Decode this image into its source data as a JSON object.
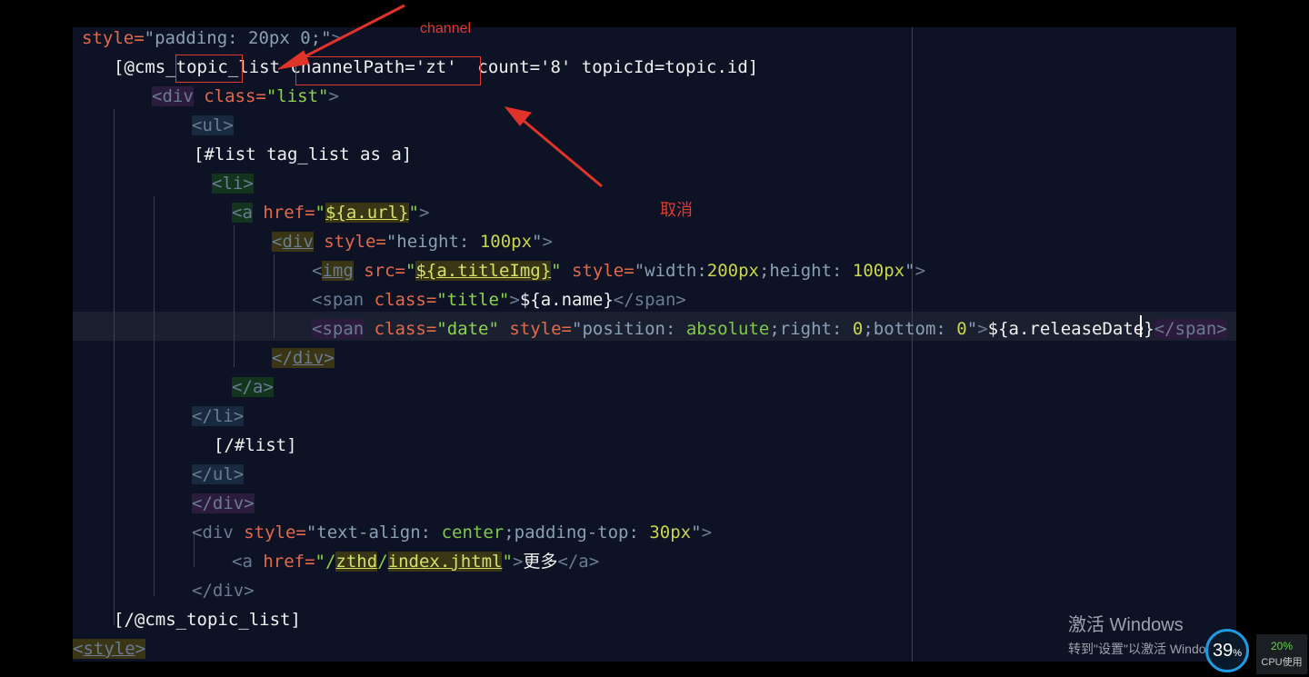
{
  "code_lines": [
    [
      {
        "t": "style=",
        "c": "tk-attr"
      },
      {
        "t": "\"padding: 20px 0;\"",
        "c": "tk-val"
      },
      {
        "t": ">",
        "c": "tk-tag"
      }
    ],
    [
      {
        "t": "[@cms_",
        "c": "tk-txt"
      },
      {
        "t": "topic_",
        "c": "tk-txt"
      },
      {
        "t": "list ",
        "c": "tk-txt"
      },
      {
        "t": "channelPath='zt'",
        "c": "tk-txt"
      },
      {
        "t": "  count='8' topicId=topic.id]",
        "c": "tk-txt"
      }
    ],
    [
      {
        "t": "<div",
        "c": "tk-tag hl-p"
      },
      {
        "t": " class=",
        "c": "tk-attr"
      },
      {
        "t": "\"list\"",
        "c": "tk-str"
      },
      {
        "t": ">",
        "c": "tk-tag"
      }
    ],
    [
      {
        "t": "<ul>",
        "c": "tk-tag hl-b"
      }
    ],
    [
      {
        "t": "[#list tag_list as a]",
        "c": "tk-txt"
      }
    ],
    [
      {
        "t": "<li>",
        "c": "tk-tag hl-g"
      }
    ],
    [
      {
        "t": "<a",
        "c": "tk-tag hl-g"
      },
      {
        "t": " href=",
        "c": "tk-attr"
      },
      {
        "t": "\"",
        "c": "tk-str"
      },
      {
        "t": "${a.url}",
        "c": "tk-interp hl-y"
      },
      {
        "t": "\"",
        "c": "tk-str"
      },
      {
        "t": ">",
        "c": "tk-tag"
      }
    ],
    [
      {
        "t": "<",
        "c": "tk-tag hl-y"
      },
      {
        "t": "div",
        "c": "tk-tag hl-y ul"
      },
      {
        "t": " style=",
        "c": "tk-attr"
      },
      {
        "t": "\"height: ",
        "c": "tk-val"
      },
      {
        "t": "100px",
        "c": "tk-num"
      },
      {
        "t": "\"",
        "c": "tk-val"
      },
      {
        "t": ">",
        "c": "tk-tag"
      }
    ],
    [
      {
        "t": "<",
        "c": "tk-tag"
      },
      {
        "t": "img",
        "c": "tk-tag hl-y ul"
      },
      {
        "t": " src=",
        "c": "tk-attr"
      },
      {
        "t": "\"",
        "c": "tk-str"
      },
      {
        "t": "${a.titleImg}",
        "c": "tk-interp hl-y"
      },
      {
        "t": "\"",
        "c": "tk-str"
      },
      {
        "t": " style=",
        "c": "tk-attr"
      },
      {
        "t": "\"width:",
        "c": "tk-val"
      },
      {
        "t": "200px",
        "c": "tk-num"
      },
      {
        "t": ";height: ",
        "c": "tk-val"
      },
      {
        "t": "100px",
        "c": "tk-num"
      },
      {
        "t": "\"",
        "c": "tk-val"
      },
      {
        "t": ">",
        "c": "tk-tag"
      }
    ],
    [
      {
        "t": "<span",
        "c": "tk-tag"
      },
      {
        "t": " class=",
        "c": "tk-attr"
      },
      {
        "t": "\"title\"",
        "c": "tk-str"
      },
      {
        "t": ">",
        "c": "tk-tag"
      },
      {
        "t": "${a.name}",
        "c": "tk-txt"
      },
      {
        "t": "</span>",
        "c": "tk-tag"
      }
    ],
    [
      {
        "t": "<span",
        "c": "tk-tag hl-p"
      },
      {
        "t": " class=",
        "c": "tk-attr"
      },
      {
        "t": "\"date\"",
        "c": "tk-str"
      },
      {
        "t": " style=",
        "c": "tk-attr"
      },
      {
        "t": "\"position: ",
        "c": "tk-val"
      },
      {
        "t": "absolute",
        "c": "tk-kw"
      },
      {
        "t": ";right: ",
        "c": "tk-val"
      },
      {
        "t": "0",
        "c": "tk-num"
      },
      {
        "t": ";bottom: ",
        "c": "tk-val"
      },
      {
        "t": "0",
        "c": "tk-num"
      },
      {
        "t": "\"",
        "c": "tk-val"
      },
      {
        "t": ">",
        "c": "tk-tag"
      },
      {
        "t": "${a.releaseDate}",
        "c": "tk-txt"
      },
      {
        "t": "</span>",
        "c": "tk-tag hl-p"
      }
    ],
    [
      {
        "t": "</",
        "c": "tk-tag hl-y"
      },
      {
        "t": "div",
        "c": "tk-tag hl-y ul"
      },
      {
        "t": ">",
        "c": "tk-tag hl-y"
      }
    ],
    [
      {
        "t": "</a>",
        "c": "tk-tag hl-g"
      }
    ],
    [
      {
        "t": "</li>",
        "c": "tk-tag hl-b"
      }
    ],
    [
      {
        "t": "[/#list]",
        "c": "tk-txt"
      }
    ],
    [
      {
        "t": "</ul>",
        "c": "tk-tag hl-b"
      }
    ],
    [
      {
        "t": "</div>",
        "c": "tk-tag hl-p"
      }
    ],
    [
      {
        "t": "<div",
        "c": "tk-tag"
      },
      {
        "t": " style=",
        "c": "tk-attr"
      },
      {
        "t": "\"text-align: ",
        "c": "tk-val"
      },
      {
        "t": "center",
        "c": "tk-kw"
      },
      {
        "t": ";padding-top: ",
        "c": "tk-val"
      },
      {
        "t": "30px",
        "c": "tk-num"
      },
      {
        "t": "\"",
        "c": "tk-val"
      },
      {
        "t": ">",
        "c": "tk-tag"
      }
    ],
    [
      {
        "t": "<a",
        "c": "tk-tag"
      },
      {
        "t": " href=",
        "c": "tk-attr"
      },
      {
        "t": "\"/",
        "c": "tk-str"
      },
      {
        "t": "zthd",
        "c": "tk-interp hl-y"
      },
      {
        "t": "/",
        "c": "tk-str"
      },
      {
        "t": "index.jhtml",
        "c": "tk-interp hl-y"
      },
      {
        "t": "\"",
        "c": "tk-str"
      },
      {
        "t": ">",
        "c": "tk-tag"
      },
      {
        "t": "更多",
        "c": "tk-txt"
      },
      {
        "t": "</a>",
        "c": "tk-tag"
      }
    ],
    [
      {
        "t": "</div>",
        "c": "tk-tag"
      }
    ],
    [
      {
        "t": "[/@cms_topic_list]",
        "c": "tk-txt"
      }
    ],
    [
      {
        "t": "<",
        "c": "tk-tag hl-y"
      },
      {
        "t": "style",
        "c": "tk-tag hl-y ul"
      },
      {
        "t": ">",
        "c": "tk-tag hl-y"
      }
    ]
  ],
  "annotations": {
    "channel_label": "channel",
    "cancel_label": "取消"
  },
  "watermark": {
    "line1": "激活 Windows",
    "line2": "转到\"设置\"以激活 Windows。"
  },
  "cpu_widget": {
    "percent": "39",
    "percent_sign": "%",
    "cpu_value": "20%",
    "cpu_label": "CPU使用"
  }
}
